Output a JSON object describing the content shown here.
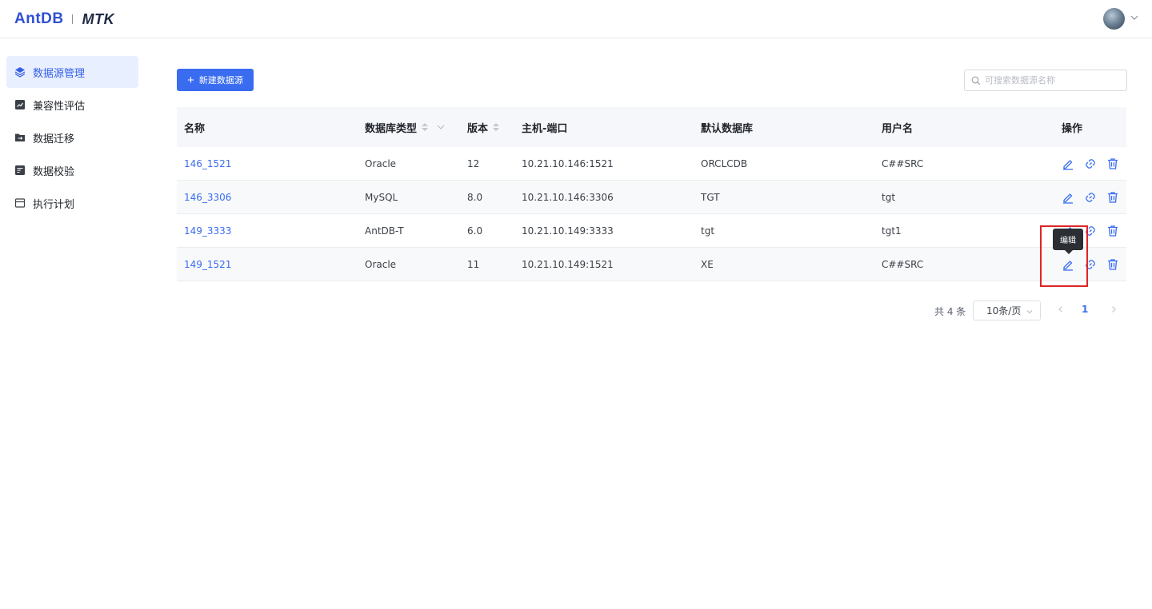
{
  "header": {
    "logo_antdb": "AntDB",
    "logo_mtk": "MTK",
    "avatar_icon": "user-avatar"
  },
  "sidebar": {
    "items": [
      {
        "label": "数据源管理",
        "icon": "layers-icon",
        "active": true
      },
      {
        "label": "兼容性评估",
        "icon": "chart-icon",
        "active": false
      },
      {
        "label": "数据迁移",
        "icon": "folder-transfer-icon",
        "active": false
      },
      {
        "label": "数据校验",
        "icon": "check-doc-icon",
        "active": false
      },
      {
        "label": "执行计划",
        "icon": "calendar-icon",
        "active": false
      }
    ]
  },
  "toolbar": {
    "new_button_label": "新建数据源",
    "search_placeholder": "可搜索数据源名称"
  },
  "table": {
    "headers": {
      "name": "名称",
      "type": "数据库类型",
      "version": "版本",
      "host": "主机-端口",
      "default_db": "默认数据库",
      "user": "用户名",
      "ops": "操作"
    },
    "rows": [
      {
        "name": "146_1521",
        "type": "Oracle",
        "version": "12",
        "host": "10.21.10.146:1521",
        "default_db": "ORCLCDB",
        "user": "C##SRC"
      },
      {
        "name": "146_3306",
        "type": "MySQL",
        "version": "8.0",
        "host": "10.21.10.146:3306",
        "default_db": "TGT",
        "user": "tgt"
      },
      {
        "name": "149_3333",
        "type": "AntDB-T",
        "version": "6.0",
        "host": "10.21.10.149:3333",
        "default_db": "tgt",
        "user": "tgt1"
      },
      {
        "name": "149_1521",
        "type": "Oracle",
        "version": "11",
        "host": "10.21.10.149:1521",
        "default_db": "XE",
        "user": "C##SRC"
      }
    ]
  },
  "tooltip": {
    "label": "编辑"
  },
  "pagination": {
    "total": "共 4 条",
    "page_size": "10条/页",
    "current_page": "1"
  },
  "colors": {
    "primary": "#3a6cf0",
    "highlight": "#e02424"
  }
}
